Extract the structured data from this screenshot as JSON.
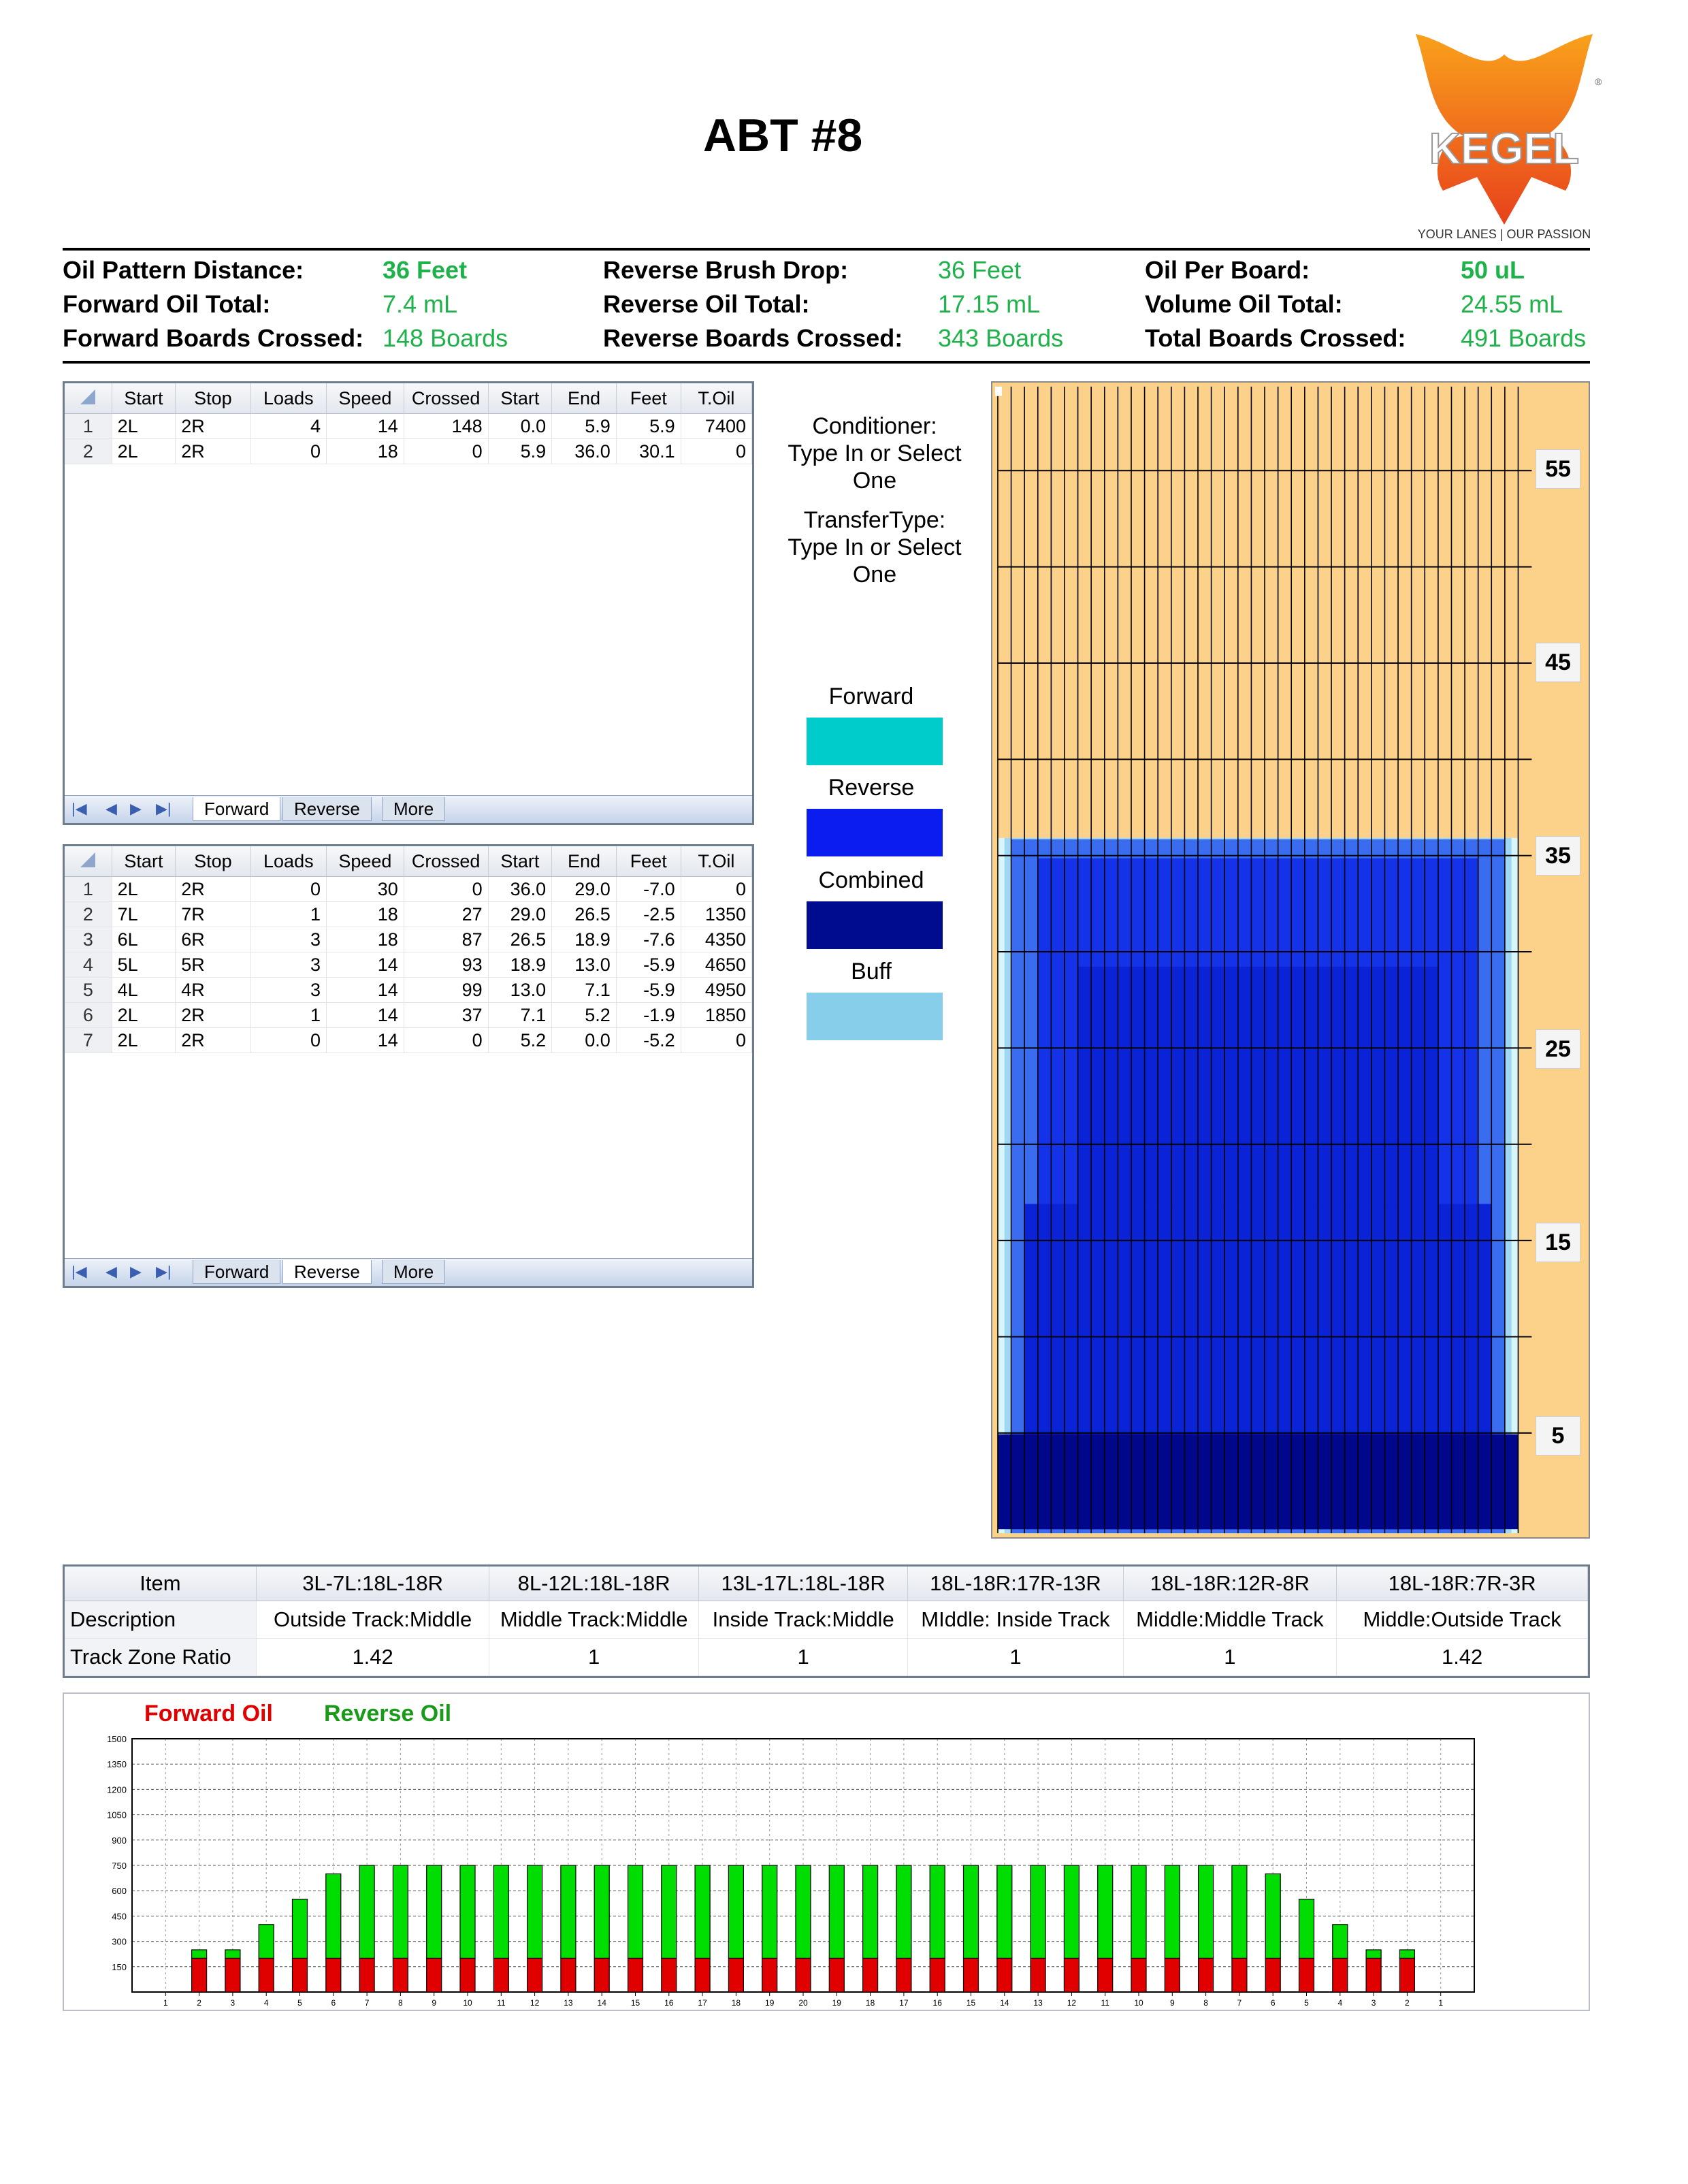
{
  "title": "ABT #8",
  "logo": {
    "brand": "KEGEL",
    "tagline": "YOUR LANES | OUR PASSION",
    "registered": "®"
  },
  "summary": {
    "rows": [
      [
        {
          "label": "Oil Pattern Distance:",
          "value": "36 Feet",
          "bold": true
        },
        {
          "label": "Reverse Brush Drop:",
          "value": "36 Feet"
        },
        {
          "label": "Oil Per Board:",
          "value": "50 uL",
          "bold": true
        }
      ],
      [
        {
          "label": "Forward Oil Total:",
          "value": "7.4 mL"
        },
        {
          "label": "Reverse Oil Total:",
          "value": "17.15 mL"
        },
        {
          "label": "Volume Oil Total:",
          "value": "24.55 mL"
        }
      ],
      [
        {
          "label": "Forward Boards Crossed:",
          "value": "148 Boards"
        },
        {
          "label": "Reverse Boards Crossed:",
          "value": "343 Boards"
        },
        {
          "label": "Total Boards Crossed:",
          "value": "491 Boards"
        }
      ]
    ]
  },
  "grid_columns": [
    "Start",
    "Stop",
    "Loads",
    "Speed",
    "Crossed",
    "Start",
    "End",
    "Feet",
    "T.Oil"
  ],
  "forward_grid": {
    "rows": [
      [
        "1",
        "2L",
        "2R",
        "4",
        "14",
        "148",
        "0.0",
        "5.9",
        "5.9",
        "7400"
      ],
      [
        "2",
        "2L",
        "2R",
        "0",
        "18",
        "0",
        "5.9",
        "36.0",
        "30.1",
        "0"
      ]
    ],
    "tabs": [
      "Forward",
      "Reverse",
      "More"
    ],
    "active_tab": "Forward"
  },
  "reverse_grid": {
    "rows": [
      [
        "1",
        "2L",
        "2R",
        "0",
        "30",
        "0",
        "36.0",
        "29.0",
        "-7.0",
        "0"
      ],
      [
        "2",
        "7L",
        "7R",
        "1",
        "18",
        "27",
        "29.0",
        "26.5",
        "-2.5",
        "1350"
      ],
      [
        "3",
        "6L",
        "6R",
        "3",
        "18",
        "87",
        "26.5",
        "18.9",
        "-7.6",
        "4350"
      ],
      [
        "4",
        "5L",
        "5R",
        "3",
        "14",
        "93",
        "18.9",
        "13.0",
        "-5.9",
        "4650"
      ],
      [
        "5",
        "4L",
        "4R",
        "3",
        "14",
        "99",
        "13.0",
        "7.1",
        "-5.9",
        "4950"
      ],
      [
        "6",
        "2L",
        "2R",
        "1",
        "14",
        "37",
        "7.1",
        "5.2",
        "-1.9",
        "1850"
      ],
      [
        "7",
        "2L",
        "2R",
        "0",
        "14",
        "0",
        "5.2",
        "0.0",
        "-5.2",
        "0"
      ]
    ],
    "tabs": [
      "Forward",
      "Reverse",
      "More"
    ],
    "active_tab": "Reverse"
  },
  "side_info": {
    "conditioner": [
      "Conditioner:",
      "Type In or Select",
      "One"
    ],
    "transfer": [
      "TransferType:",
      "Type In or Select",
      "One"
    ]
  },
  "legend": [
    {
      "label": "Forward",
      "color": "#00cccc"
    },
    {
      "label": "Reverse",
      "color": "#0a1cf0"
    },
    {
      "label": "Combined",
      "color": "#000c8f"
    },
    {
      "label": "Buff",
      "color": "#87ceeb"
    }
  ],
  "lane_chart": {
    "y_ticks": [
      "55",
      "45",
      "35",
      "25",
      "15",
      "5"
    ],
    "colors": {
      "lane": "#fcd28a",
      "grid": "#000000",
      "combined": "#00078a",
      "reverse": "#1432e8",
      "light": "#3a6cf0",
      "buff": "#9fd8f4",
      "pale": "#d8f6fa"
    }
  },
  "ratio_table": {
    "headers": [
      "Item",
      "3L-7L:18L-18R",
      "8L-12L:18L-18R",
      "13L-17L:18L-18R",
      "18L-18R:17R-13R",
      "18L-18R:12R-8R",
      "18L-18R:7R-3R"
    ],
    "rows": [
      [
        "Description",
        "Outside Track:Middle",
        "Middle Track:Middle",
        "Inside Track:Middle",
        "MIddle: Inside Track",
        "Middle:Middle Track",
        "Middle:Outside Track"
      ],
      [
        "Track Zone Ratio",
        "1.42",
        "1",
        "1",
        "1",
        "1",
        "1.42"
      ]
    ]
  },
  "chart_data": {
    "type": "bar",
    "legend": [
      {
        "name": "Forward Oil",
        "color": "#e00000"
      },
      {
        "name": "Reverse Oil",
        "color": "#00dd00"
      }
    ],
    "categories": [
      "1",
      "2",
      "3",
      "4",
      "5",
      "6",
      "7",
      "8",
      "9",
      "10",
      "11",
      "12",
      "13",
      "14",
      "15",
      "16",
      "17",
      "18",
      "19",
      "20",
      "19",
      "18",
      "17",
      "16",
      "15",
      "14",
      "13",
      "12",
      "11",
      "10",
      "9",
      "8",
      "7",
      "6",
      "5",
      "4",
      "3",
      "2",
      "1"
    ],
    "series": [
      {
        "name": "Forward Oil",
        "values": [
          0,
          200,
          200,
          200,
          200,
          200,
          200,
          200,
          200,
          200,
          200,
          200,
          200,
          200,
          200,
          200,
          200,
          200,
          200,
          200,
          200,
          200,
          200,
          200,
          200,
          200,
          200,
          200,
          200,
          200,
          200,
          200,
          200,
          200,
          200,
          200,
          200,
          200,
          0
        ]
      },
      {
        "name": "Reverse Oil",
        "values": [
          0,
          50,
          50,
          200,
          350,
          500,
          550,
          550,
          550,
          550,
          550,
          550,
          550,
          550,
          550,
          550,
          550,
          550,
          550,
          550,
          550,
          550,
          550,
          550,
          550,
          550,
          550,
          550,
          550,
          550,
          550,
          550,
          550,
          500,
          350,
          200,
          50,
          50,
          0
        ]
      }
    ],
    "stacked": true,
    "y_ticks": [
      "1500",
      "1350",
      "1200",
      "1050",
      "900",
      "750",
      "600",
      "450",
      "300",
      "150"
    ],
    "ylim": [
      0,
      1500
    ]
  }
}
